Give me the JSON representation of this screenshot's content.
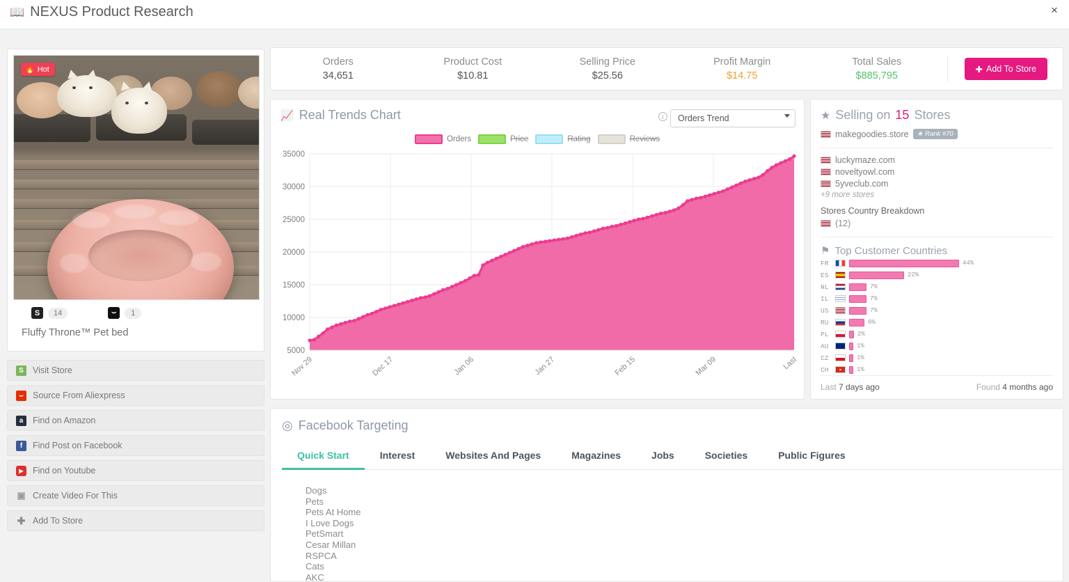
{
  "header": {
    "title": "NEXUS Product Research",
    "book_icon": "book-icon",
    "close_icon": "×"
  },
  "product": {
    "hot_badge": "Hot",
    "hot_icon": "🔥",
    "title": "Fluffy Throne™ Pet bed",
    "shopify_count": "14",
    "aliexpress_count": "1",
    "shopify_icon_letter": "S",
    "ali_icon_letter": "⌣"
  },
  "actions": [
    {
      "label": "Visit Store",
      "icon": "shopify-icon",
      "glyph": "S"
    },
    {
      "label": "Source From Aliexpress",
      "icon": "aliexpress-icon",
      "glyph": "⌣"
    },
    {
      "label": "Find on Amazon",
      "icon": "amazon-icon",
      "glyph": "a"
    },
    {
      "label": "Find Post on Facebook",
      "icon": "facebook-icon",
      "glyph": "f"
    },
    {
      "label": "Find on Youtube",
      "icon": "youtube-icon",
      "glyph": "▶"
    },
    {
      "label": "Create Video For This",
      "icon": "video-icon",
      "glyph": "▣"
    },
    {
      "label": "Add To Store",
      "icon": "plus-icon",
      "glyph": "✚"
    }
  ],
  "stats": {
    "items": [
      {
        "label": "Orders",
        "value": "34,651",
        "color": "#555555"
      },
      {
        "label": "Product Cost",
        "value": "$10.81",
        "color": "#555555"
      },
      {
        "label": "Selling Price",
        "value": "$25.56",
        "color": "#555555"
      },
      {
        "label": "Profit Margin",
        "value": "$14.75",
        "color": "#f0a22e"
      },
      {
        "label": "Total Sales",
        "value": "$885,795",
        "color": "#57c26b"
      }
    ],
    "add_to_store": "Add To Store",
    "add_icon": "✚"
  },
  "chart": {
    "title": "Real Trends Chart",
    "chart_icon": "chart-icon",
    "info_icon": "i",
    "select_value": "Orders Trend",
    "legend": [
      {
        "label": "Orders",
        "color": "#ec3b8f",
        "active": true
      },
      {
        "label": "Price",
        "color": "#79d43f",
        "active": false
      },
      {
        "label": "Rating",
        "color": "#96dff0",
        "active": false
      },
      {
        "label": "Reviews",
        "color": "#dedcd4",
        "active": false
      }
    ]
  },
  "chart_data": {
    "type": "area",
    "title": "Real Trends Chart",
    "xlabel": "",
    "ylabel": "",
    "ylim": [
      5000,
      35000
    ],
    "yticks": [
      5000,
      10000,
      15000,
      20000,
      25000,
      30000,
      35000
    ],
    "xticks": [
      "Nov 29",
      "Dec 17",
      "Jan 06",
      "Jan 27",
      "Feb 15",
      "Mar 09",
      "Last"
    ],
    "grid": true,
    "legend_position": "top-center",
    "series": [
      {
        "name": "Orders",
        "color": "#ec3b8f",
        "fill": "#f06ba8",
        "values": [
          6500,
          6600,
          7100,
          7600,
          8200,
          8500,
          8800,
          9000,
          9200,
          9400,
          9500,
          9800,
          10100,
          10400,
          10600,
          10900,
          11200,
          11400,
          11600,
          11800,
          12000,
          12200,
          12400,
          12600,
          12800,
          13000,
          13100,
          13300,
          13600,
          13900,
          14200,
          14400,
          14700,
          15000,
          15300,
          15600,
          16000,
          16400,
          16500,
          18000,
          18400,
          18700,
          19000,
          19300,
          19600,
          19900,
          20200,
          20500,
          20800,
          21000,
          21200,
          21400,
          21500,
          21600,
          21700,
          21800,
          21900,
          22000,
          22100,
          22300,
          22500,
          22700,
          22900,
          23000,
          23200,
          23400,
          23600,
          23700,
          23900,
          24000,
          24200,
          24400,
          24600,
          24800,
          25000,
          25100,
          25300,
          25500,
          25700,
          25900,
          26000,
          26200,
          26400,
          26700,
          27200,
          27800,
          28000,
          28200,
          28300,
          28500,
          28700,
          28900,
          29100,
          29300,
          29600,
          29900,
          30200,
          30500,
          30800,
          31000,
          31200,
          31400,
          31800,
          32400,
          32900,
          33300,
          33600,
          33900,
          34200,
          34651
        ]
      }
    ]
  },
  "stores": {
    "title_prefix": "Selling on",
    "count": "15",
    "title_suffix": "Stores",
    "star_icon": "★",
    "main_store": {
      "name": "makegoodies.store",
      "rank": "Rank #70",
      "flag": "US"
    },
    "other_stores": [
      {
        "name": "luckymaze.com",
        "flag": "US"
      },
      {
        "name": "noveltyowl.com",
        "flag": "US"
      },
      {
        "name": "5yveclub.com",
        "flag": "US"
      }
    ],
    "more_stores": "+9 more stores",
    "breakdown_label": "Stores Country Breakdown",
    "breakdown": [
      {
        "flag": "US",
        "count": "(12)"
      }
    ],
    "countries_title": "Top Customer Countries",
    "flag_icon": "⚑",
    "countries": [
      {
        "code": "FR",
        "pct": 44,
        "label": "44%"
      },
      {
        "code": "ES",
        "pct": 22,
        "label": "22%"
      },
      {
        "code": "NL",
        "pct": 7,
        "label": "7%"
      },
      {
        "code": "IL",
        "pct": 7,
        "label": "7%"
      },
      {
        "code": "US",
        "pct": 7,
        "label": "7%"
      },
      {
        "code": "RU",
        "pct": 6,
        "label": "6%"
      },
      {
        "code": "PL",
        "pct": 2,
        "label": "2%"
      },
      {
        "code": "AU",
        "pct": 1,
        "label": "1%"
      },
      {
        "code": "CZ",
        "pct": 1,
        "label": "1%"
      },
      {
        "code": "CH",
        "pct": 1,
        "label": "1%"
      }
    ],
    "footer": {
      "last_label": "Last",
      "last_value": "7 days ago",
      "found_label": "Found",
      "found_value": "4 months ago"
    }
  },
  "facebook": {
    "title": "Facebook Targeting",
    "target_icon": "target-icon",
    "tabs": [
      {
        "label": "Quick Start",
        "active": true
      },
      {
        "label": "Interest",
        "active": false
      },
      {
        "label": "Websites And Pages",
        "active": false
      },
      {
        "label": "Magazines",
        "active": false
      },
      {
        "label": "Jobs",
        "active": false
      },
      {
        "label": "Societies",
        "active": false
      },
      {
        "label": "Public Figures",
        "active": false
      }
    ],
    "interests": [
      "Dogs",
      "Pets",
      "Pets At Home",
      "I Love Dogs",
      "PetSmart",
      "Cesar Millan",
      "RSPCA",
      "Cats",
      "AKC"
    ]
  }
}
